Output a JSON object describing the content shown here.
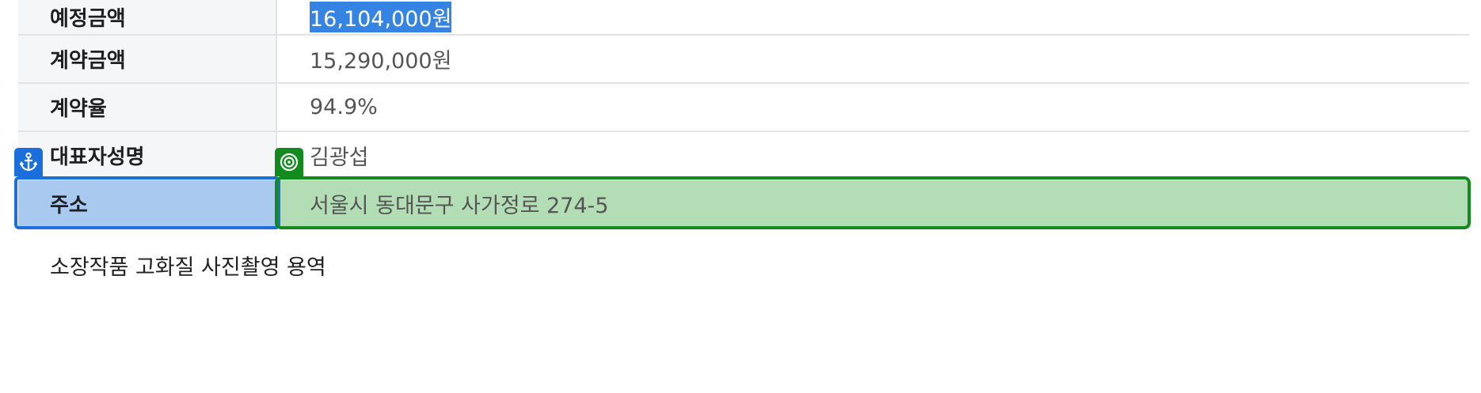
{
  "table": {
    "rows": [
      {
        "label": "예정금액",
        "value": "16,104,000원"
      },
      {
        "label": "계약금액",
        "value": "15,290,000원"
      },
      {
        "label": "계약율",
        "value": "94.9%"
      },
      {
        "label": "대표자성명",
        "value": "김광섭"
      },
      {
        "label": "주소",
        "value": "서울시 동대문구 사가정로 274-5"
      }
    ]
  },
  "footnote": "소장작품 고화질 사진촬영 용역",
  "overlay": {
    "anchor_icon": "anchor-icon",
    "target_icon": "target-icon",
    "anchor_color": "#1b6fdc",
    "target_color": "#138a1e"
  },
  "selection": {
    "color": "#3584e4"
  }
}
